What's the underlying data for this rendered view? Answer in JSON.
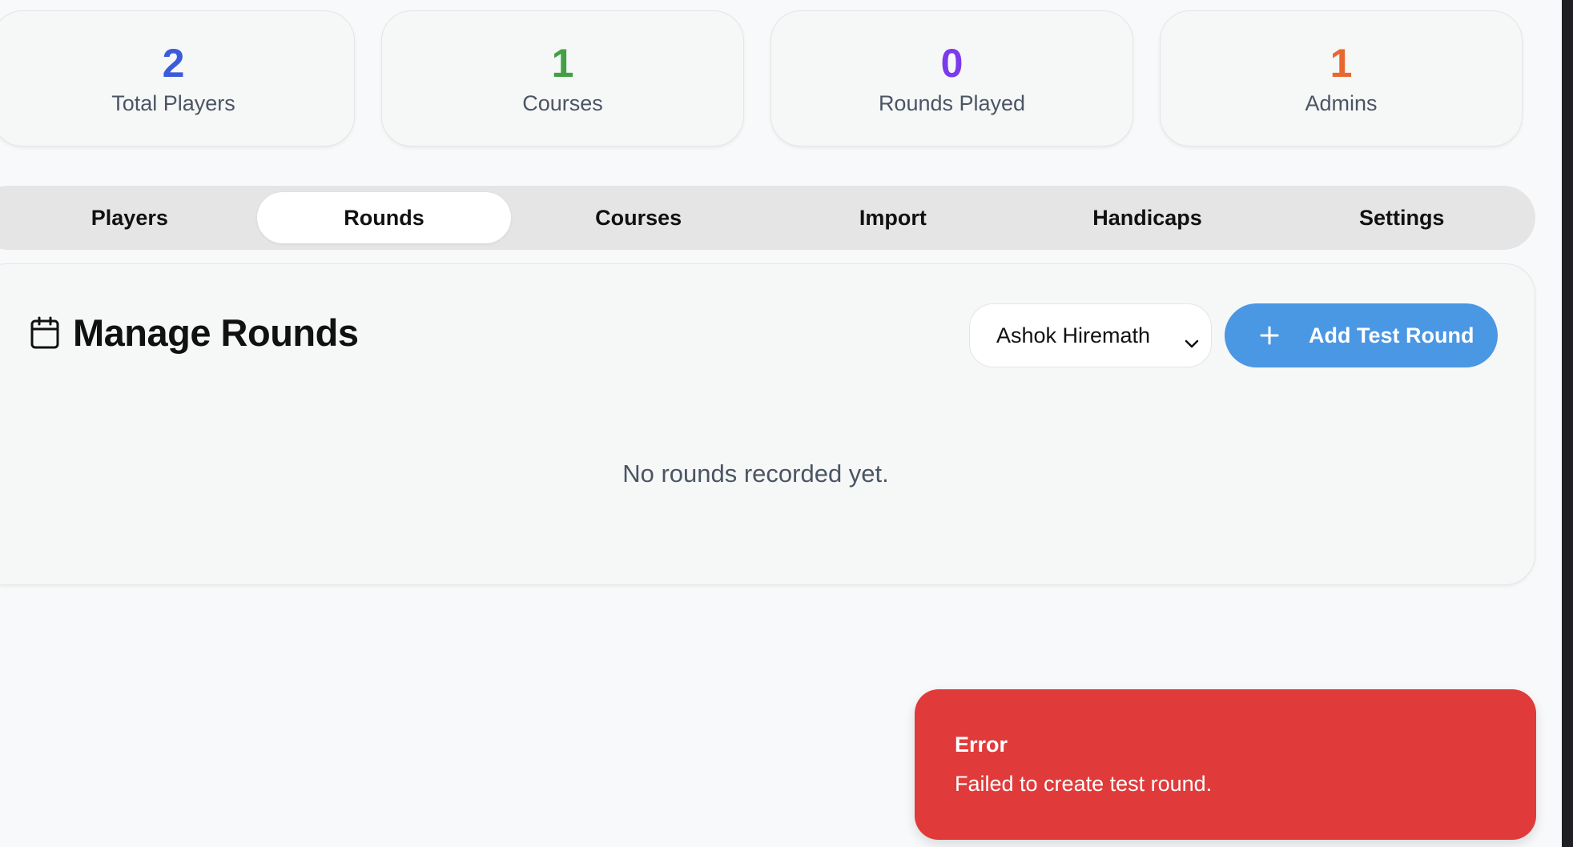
{
  "stats": [
    {
      "value": "2",
      "label": "Total Players",
      "color": "#3b5bdb"
    },
    {
      "value": "1",
      "label": "Courses",
      "color": "#43a047"
    },
    {
      "value": "0",
      "label": "Rounds Played",
      "color": "#7c3aed"
    },
    {
      "value": "1",
      "label": "Admins",
      "color": "#e8682f"
    }
  ],
  "tabs": [
    {
      "label": "Players",
      "active": false
    },
    {
      "label": "Rounds",
      "active": true
    },
    {
      "label": "Courses",
      "active": false
    },
    {
      "label": "Import",
      "active": false
    },
    {
      "label": "Handicaps",
      "active": false
    },
    {
      "label": "Settings",
      "active": false
    }
  ],
  "panel": {
    "title": "Manage Rounds",
    "icon": "calendar-icon",
    "player_select": {
      "value": "Ashok Hiremath"
    },
    "add_button": {
      "label": "Add Test Round",
      "icon": "plus-icon",
      "color": "#4a97e4"
    },
    "empty_message": "No rounds recorded yet."
  },
  "toast": {
    "title": "Error",
    "message": "Failed to create test round.",
    "color": "#e03a3a"
  }
}
